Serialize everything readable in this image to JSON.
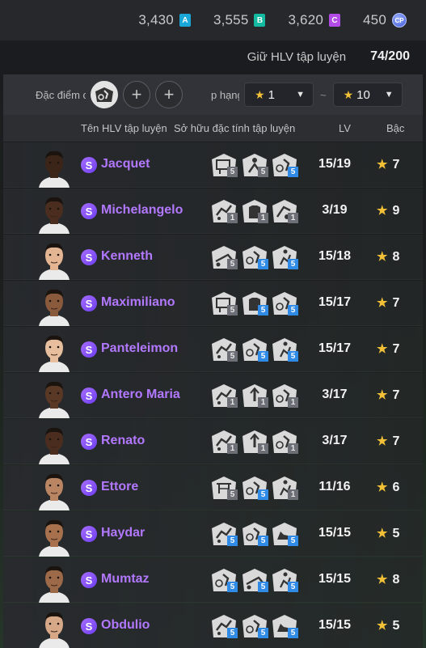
{
  "currencies": [
    {
      "value": "3,430",
      "badge": "A",
      "color": "#19a7d8"
    },
    {
      "value": "3,555",
      "badge": "B",
      "color": "#13b9a0"
    },
    {
      "value": "3,620",
      "badge": "C",
      "color": "#b34be8"
    },
    {
      "value": "450",
      "badge": "CP",
      "icon": "cp-coin-icon"
    }
  ],
  "keep": {
    "label": "Giữ HLV tập luyện",
    "count": "74/200"
  },
  "filters": {
    "traits_label": "Đặc điểm c",
    "rank_label": "p hạng",
    "rank_min": "1",
    "rank_max": "10",
    "separator": "~"
  },
  "columns": {
    "name": "Tên HLV tập luyện",
    "traits": "Sở hữu đặc tính tập luyện",
    "lv": "LV",
    "grade": "Bậc"
  },
  "rows": [
    {
      "badge": "S",
      "name": "Jacquet",
      "lv": "15/19",
      "grade": "7",
      "skin": "#3b2418",
      "traits": [
        {
          "icon": "goalkeeper-icon",
          "lv": "5",
          "c": "g"
        },
        {
          "icon": "header-icon",
          "lv": "5",
          "c": "g"
        },
        {
          "icon": "dribble-icon",
          "lv": "5",
          "c": "b"
        }
      ]
    },
    {
      "badge": "S",
      "name": "Michelangelo",
      "lv": "3/19",
      "grade": "9",
      "skin": "#4a2d1e",
      "traits": [
        {
          "icon": "power-icon",
          "lv": "1",
          "c": "g"
        },
        {
          "icon": "jersey-icon",
          "lv": "1",
          "c": "g"
        },
        {
          "icon": "speed-icon",
          "lv": "1",
          "c": "g"
        }
      ]
    },
    {
      "badge": "S",
      "name": "Kenneth",
      "lv": "15/18",
      "grade": "8",
      "skin": "#e3b592",
      "traits": [
        {
          "icon": "tackle-icon",
          "lv": "5",
          "c": "g"
        },
        {
          "icon": "dribble-icon",
          "lv": "5",
          "c": "b"
        },
        {
          "icon": "run-icon",
          "lv": "5",
          "c": "b"
        }
      ]
    },
    {
      "badge": "S",
      "name": "Maximiliano",
      "lv": "15/17",
      "grade": "7",
      "skin": "#8a5a3c",
      "traits": [
        {
          "icon": "goalkeeper-icon",
          "lv": "5",
          "c": "g"
        },
        {
          "icon": "jersey-icon",
          "lv": "5",
          "c": "b"
        },
        {
          "icon": "dribble-icon",
          "lv": "5",
          "c": "b"
        }
      ]
    },
    {
      "badge": "S",
      "name": "Panteleimon",
      "lv": "15/17",
      "grade": "7",
      "skin": "#e8bf9e",
      "traits": [
        {
          "icon": "power-icon",
          "lv": "5",
          "c": "g"
        },
        {
          "icon": "dribble-icon",
          "lv": "5",
          "c": "b"
        },
        {
          "icon": "run-icon",
          "lv": "5",
          "c": "b"
        }
      ]
    },
    {
      "badge": "S",
      "name": "Antero Maria",
      "lv": "3/17",
      "grade": "7",
      "skin": "#5a3826",
      "traits": [
        {
          "icon": "power-icon",
          "lv": "1",
          "c": "g"
        },
        {
          "icon": "pass-icon",
          "lv": "1",
          "c": "g"
        },
        {
          "icon": "dribble-icon",
          "lv": "1",
          "c": "g"
        }
      ]
    },
    {
      "badge": "S",
      "name": "Renato",
      "lv": "3/17",
      "grade": "7",
      "skin": "#4a2d1e",
      "traits": [
        {
          "icon": "power-icon",
          "lv": "1",
          "c": "g"
        },
        {
          "icon": "pass-icon",
          "lv": "1",
          "c": "g"
        },
        {
          "icon": "dribble-icon",
          "lv": "1",
          "c": "g"
        }
      ]
    },
    {
      "badge": "S",
      "name": "Ettore",
      "lv": "11/16",
      "grade": "6",
      "skin": "#b98563",
      "traits": [
        {
          "icon": "crossbar-icon",
          "lv": "5",
          "c": "g"
        },
        {
          "icon": "dribble-icon",
          "lv": "5",
          "c": "b"
        },
        {
          "icon": "run-icon",
          "lv": "1",
          "c": "g"
        }
      ]
    },
    {
      "badge": "S",
      "name": "Haydar",
      "lv": "15/15",
      "grade": "5",
      "skin": "#a8714d",
      "traits": [
        {
          "icon": "power-icon",
          "lv": "5",
          "c": "b"
        },
        {
          "icon": "dribble-icon",
          "lv": "5",
          "c": "b"
        },
        {
          "icon": "shoe-icon",
          "lv": "5",
          "c": "b"
        }
      ]
    },
    {
      "badge": "S",
      "name": "Mumtaz",
      "lv": "15/15",
      "grade": "8",
      "skin": "#9c6a49",
      "traits": [
        {
          "icon": "dribble-icon",
          "lv": "5",
          "c": "b"
        },
        {
          "icon": "tackle-icon",
          "lv": "5",
          "c": "b"
        },
        {
          "icon": "run-icon",
          "lv": "5",
          "c": "b"
        }
      ]
    },
    {
      "badge": "S",
      "name": "Obdulio",
      "lv": "15/15",
      "grade": "5",
      "skin": "#d6a888",
      "traits": [
        {
          "icon": "power-icon",
          "lv": "5",
          "c": "b"
        },
        {
          "icon": "dribble-icon",
          "lv": "5",
          "c": "b"
        },
        {
          "icon": "shoe-icon",
          "lv": "5",
          "c": "b"
        }
      ]
    }
  ]
}
